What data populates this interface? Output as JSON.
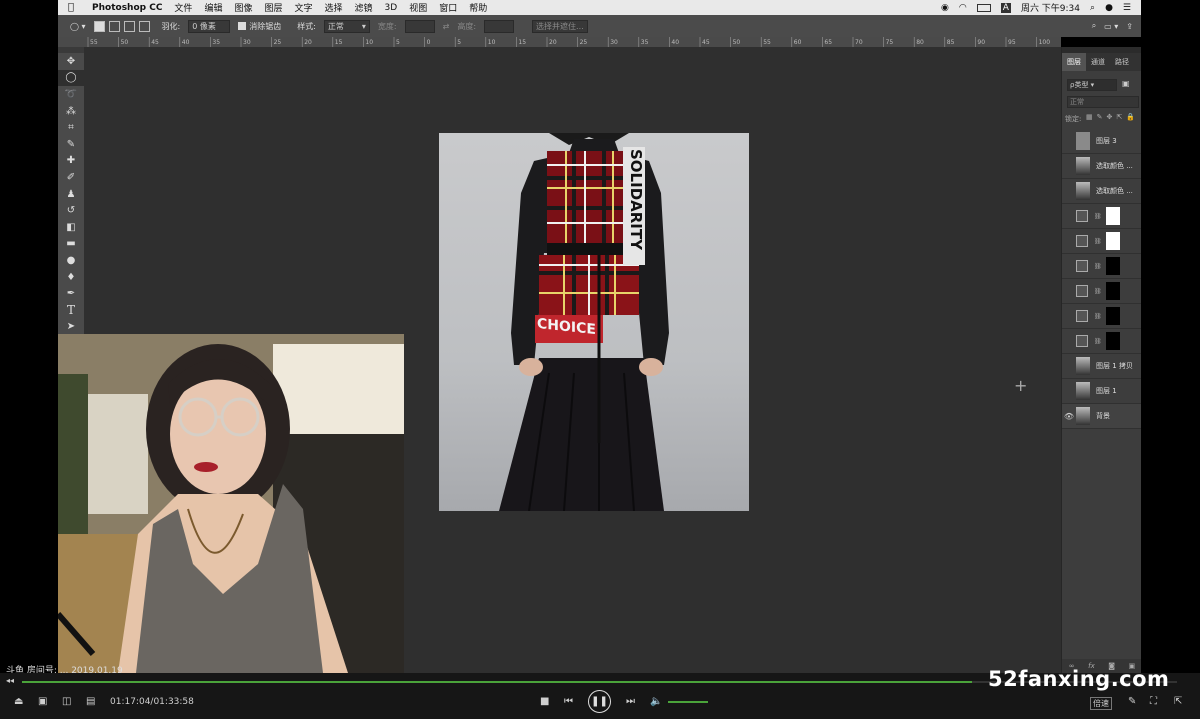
{
  "menubar": {
    "apple": "",
    "app_name": "Photoshop CC",
    "menus": [
      "文件",
      "编辑",
      "图像",
      "图层",
      "文字",
      "选择",
      "滤镜",
      "3D",
      "视图",
      "窗口",
      "帮助"
    ],
    "clock": "周六 下午9:34",
    "input_method": "A"
  },
  "options_bar": {
    "feather_label": "羽化:",
    "feather_value": "0 像素",
    "antialias_label": "消除锯齿",
    "style_label": "样式:",
    "style_value": "正常",
    "width_label": "宽度:",
    "height_label": "高度:",
    "select_mask_button": "选择并遮住..."
  },
  "ruler": {
    "ticks": [
      "55",
      "50",
      "45",
      "40",
      "35",
      "30",
      "25",
      "20",
      "15",
      "10",
      "5",
      "0",
      "5",
      "10",
      "15",
      "20",
      "25",
      "30",
      "35",
      "40",
      "45",
      "50",
      "55",
      "60",
      "65",
      "70",
      "75",
      "80",
      "85",
      "90",
      "95",
      "100",
      "105"
    ]
  },
  "toolbar": {
    "tools": [
      "move-icon",
      "marquee-icon",
      "lasso-icon",
      "magic-wand-icon",
      "crop-icon",
      "eyedropper-icon",
      "healing-icon",
      "brush-icon",
      "stamp-icon",
      "history-brush-icon",
      "eraser-icon",
      "gradient-icon",
      "blur-icon",
      "dodge-icon",
      "pen-icon",
      "type-icon",
      "path-select-icon"
    ],
    "type_glyph": "T"
  },
  "layers_panel": {
    "tabs": [
      "图层",
      "通道",
      "路径"
    ],
    "filter_label": "ρ类型",
    "blend_mode": "正常",
    "lock_label": "锁定:",
    "layers": [
      {
        "name": "图层 3",
        "thumb": "gray",
        "mask": "none",
        "visible": false
      },
      {
        "name": "选取颜色 ...",
        "thumb": "photo",
        "mask": "none",
        "visible": false
      },
      {
        "name": "选取颜色 ...",
        "thumb": "photo",
        "mask": "none",
        "visible": false
      },
      {
        "name": "",
        "thumb": "adjust",
        "mask": "white",
        "visible": false
      },
      {
        "name": "",
        "thumb": "curves",
        "mask": "white",
        "visible": false
      },
      {
        "name": "",
        "thumb": "balance",
        "mask": "black",
        "visible": false
      },
      {
        "name": "",
        "thumb": "levels",
        "mask": "black",
        "visible": false
      },
      {
        "name": "",
        "thumb": "curves",
        "mask": "black",
        "visible": false
      },
      {
        "name": "",
        "thumb": "curves",
        "mask": "black",
        "visible": false
      },
      {
        "name": "图层 1 拷贝",
        "thumb": "photo",
        "mask": "none",
        "visible": false
      },
      {
        "name": "图层 1",
        "thumb": "photo",
        "mask": "none",
        "visible": false
      },
      {
        "name": "背景",
        "thumb": "photo",
        "mask": "none",
        "visible": true
      }
    ],
    "bottom_icons": [
      "link-icon",
      "fx-icon",
      "mask-add-icon",
      "new-layer-icon"
    ],
    "fx_label": "fx"
  },
  "image": {
    "garment_text_1": "SOLIDARITY",
    "garment_text_2": "CHOICE"
  },
  "stream": {
    "room_info": "斗鱼 房间号: ... 2019.01.19",
    "time": "01:17:04/01:33:58",
    "speed_label": "倍速",
    "watermark": "52fanxing.com"
  },
  "colors": {
    "progress": "#4aa33a",
    "ps_bg": "#2f2f2f",
    "panel_bg": "#3d3d3d"
  }
}
